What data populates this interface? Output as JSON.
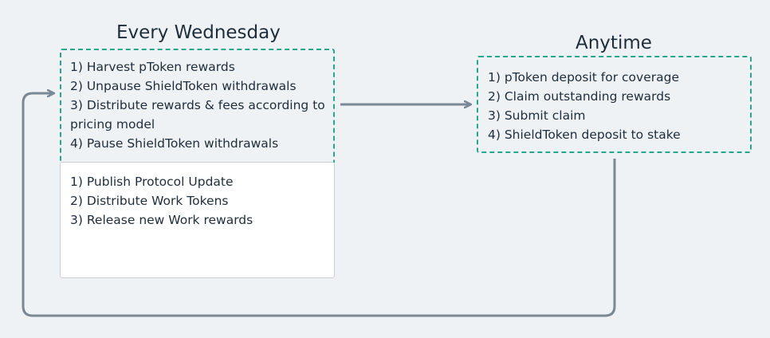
{
  "left_section": {
    "title": "Every Wednesday",
    "weekly_tasks": [
      "1) Harvest pToken rewards",
      "2) Unpause ShieldToken withdrawals",
      "3) Distribute rewards & fees according to pricing model",
      "4) Pause ShieldToken withdrawals"
    ],
    "work_tasks": [
      "1) Publish Protocol Update",
      "2) Distribute Work Tokens",
      "3) Release new Work rewards"
    ]
  },
  "right_section": {
    "title": "Anytime",
    "tasks": [
      "1) pToken deposit for coverage",
      "2) Claim outstanding rewards",
      "3) Submit claim",
      "4) ShieldToken deposit to stake"
    ]
  },
  "colors": {
    "background": "#eef2f5",
    "dashed_border": "#26a78a",
    "arrow": "#7a8794",
    "text": "#1f2d3a"
  }
}
